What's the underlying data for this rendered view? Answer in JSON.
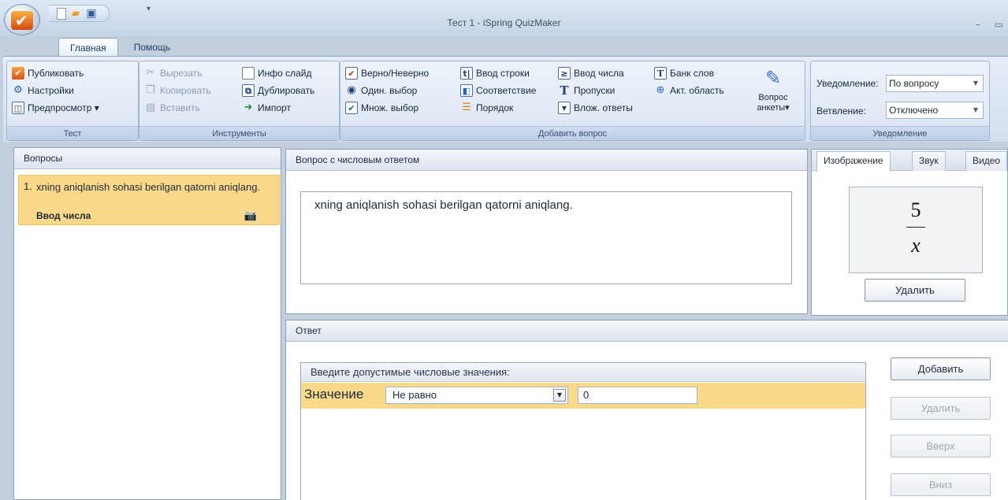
{
  "window": {
    "title": "Тест 1 - iSpring QuizMaker",
    "minimize_glyph": "–",
    "maximize_glyph": "▭"
  },
  "tabs": [
    {
      "label": "Главная",
      "active": true
    },
    {
      "label": "Помощь",
      "active": false
    }
  ],
  "ribbon": {
    "test": {
      "label": "Тест",
      "publish": "Публиковать",
      "settings": "Настройки",
      "preview": "Предпросмотр ▾"
    },
    "tools": {
      "label": "Инструменты",
      "cut": "Вырезать",
      "copy": "Копировать",
      "paste": "Вставить",
      "info_slide": "Инфо слайд",
      "duplicate": "Дублировать",
      "import": "Импорт"
    },
    "add_question": {
      "label": "Добавить вопрос",
      "true_false": "Верно/Неверно",
      "single_choice": "Один. выбор",
      "multi_choice": "Множ. выбор",
      "string_input": "Ввод строки",
      "matching": "Соответствие",
      "order": "Порядок",
      "number_input": "Ввод числа",
      "gaps": "Пропуски",
      "nested_answers": "Влож. ответы",
      "word_bank": "Банк слов",
      "hotspot": "Акт. область",
      "survey_line1": "Вопрос",
      "survey_line2": "анкеты▾"
    },
    "notification": {
      "label": "Уведомление",
      "notify_label": "Уведомление:",
      "notify_value": "По вопросу",
      "branch_label": "Ветвление:",
      "branch_value": "Отключено"
    }
  },
  "questions_panel": {
    "title": "Вопросы",
    "items": [
      {
        "number": "1.",
        "text": "xning aniqlanish sohasi berilgan qatorni aniqlang.",
        "type": "Ввод числа"
      }
    ]
  },
  "question_panel": {
    "title": "Вопрос с числовым ответом",
    "text": "xning aniqlanish sohasi berilgan qatorni aniqlang."
  },
  "media_panel": {
    "tabs": [
      "Изображение",
      "Звук",
      "Видео"
    ],
    "active_tab": "Изображение",
    "formula_num": "5",
    "formula_den": "x",
    "delete": "Удалить"
  },
  "answer_panel": {
    "title": "Ответ",
    "header": "Введите допустимые числовые значения:",
    "row_label": "Значение",
    "condition": "Не равно",
    "value": "0",
    "buttons": {
      "add": "Добавить",
      "delete": "Удалить",
      "up": "Вверх",
      "down": "Вниз"
    }
  }
}
